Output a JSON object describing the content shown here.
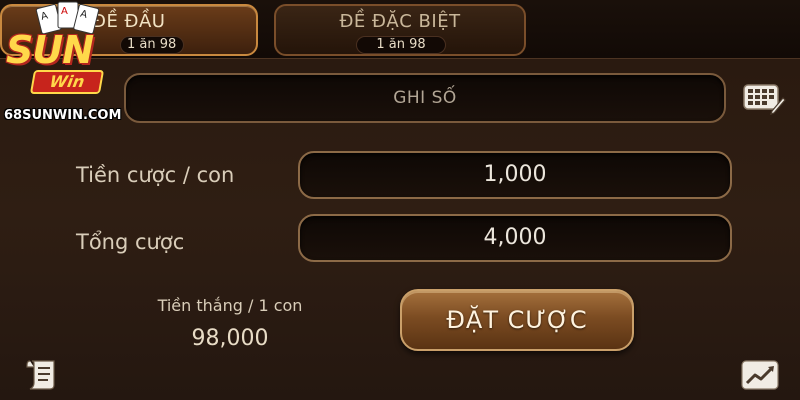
{
  "tabs": [
    {
      "title": "ĐỀ ĐẦU",
      "payout": "1 ăn 98",
      "active": true
    },
    {
      "title": "ĐỀ ĐẶC BIỆT",
      "payout": "1 ăn 98",
      "active": false
    }
  ],
  "number_input": {
    "placeholder": "GHI SỐ"
  },
  "bet_per_number": {
    "label": "Tiền cược / con",
    "value": "1,000"
  },
  "total_bet": {
    "label": "Tổng cược",
    "value": "4,000"
  },
  "winnings": {
    "label": "Tiền thắng / 1 con",
    "value": "98,000"
  },
  "place_bet_button": {
    "label": "ĐẶT CƯỢC"
  },
  "logo": {
    "brand": "SUN",
    "sub": "Win",
    "domain": "68SUNWIN.COM"
  },
  "icons": {
    "keypad": "keypad-icon",
    "history": "history-icon",
    "chart": "chart-icon"
  },
  "colors": {
    "accent_gold": "#c9893f",
    "panel_brown": "#2f1e13",
    "logo_yellow": "#ffd84a",
    "logo_red": "#c7241c"
  }
}
